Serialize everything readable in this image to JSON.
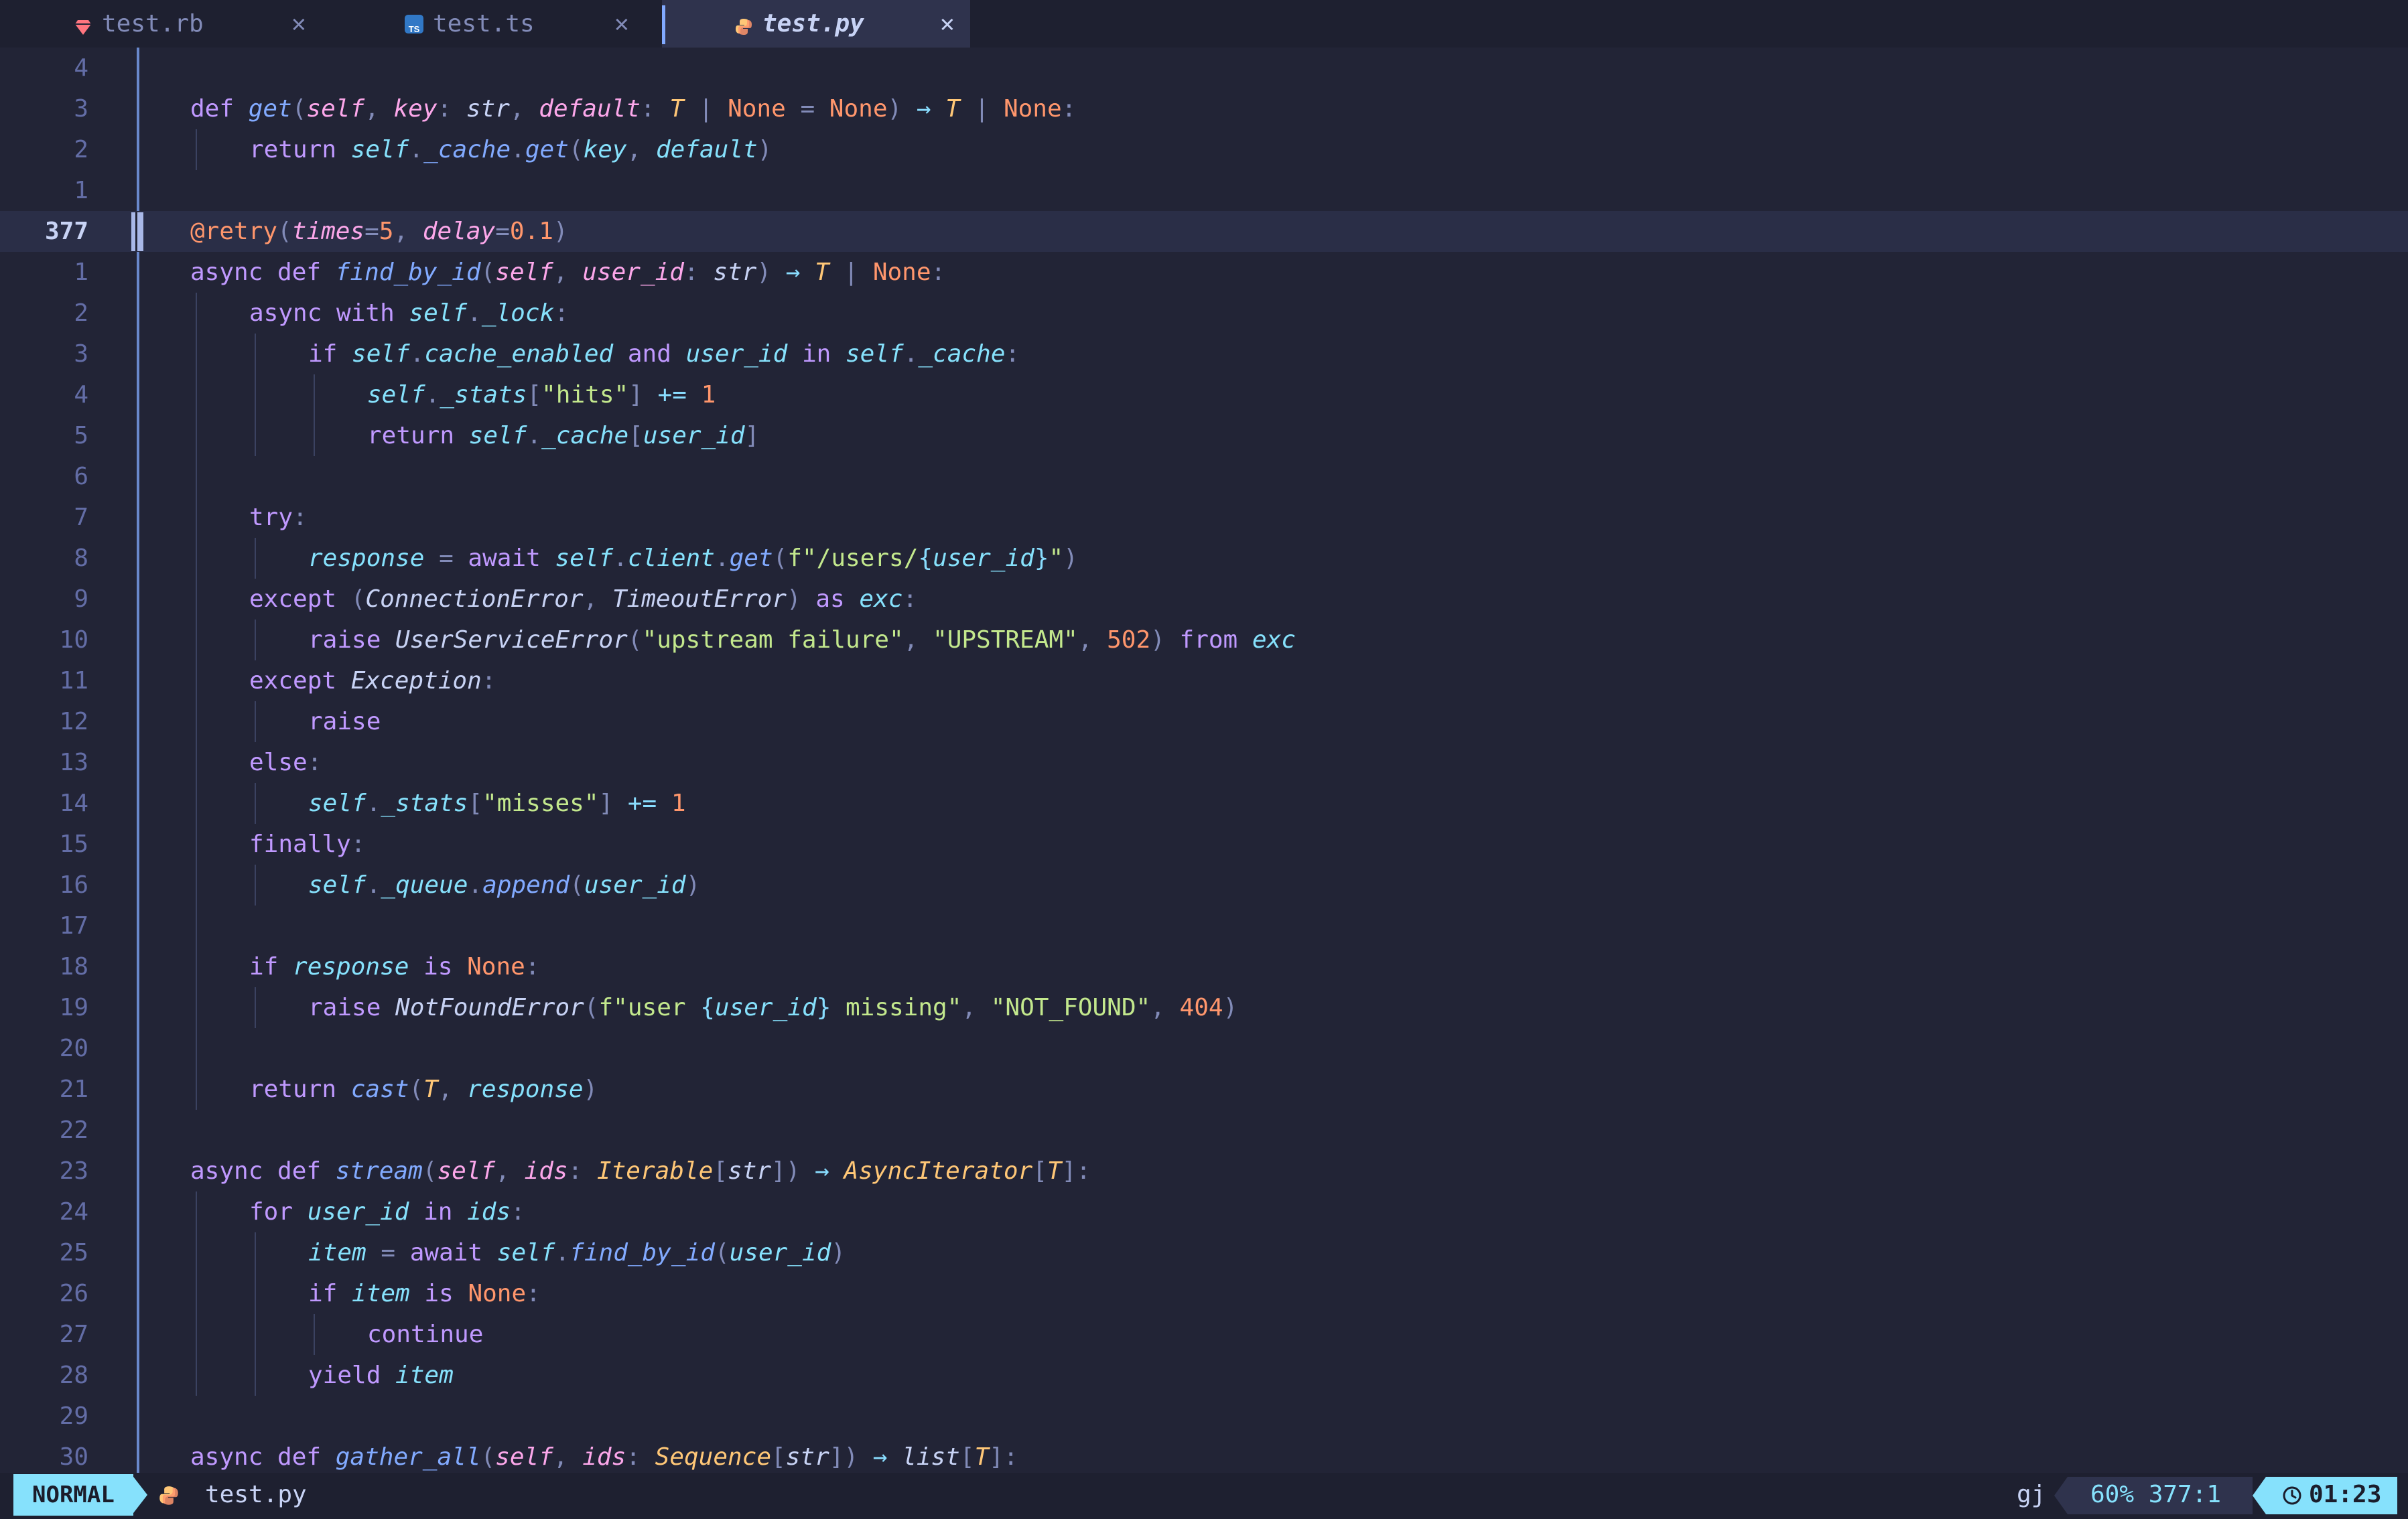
{
  "tabs": [
    {
      "label": "test.rb",
      "icon": "ruby-icon",
      "icon_color": "#ff757f"
    },
    {
      "label": "test.ts",
      "icon": "typescript-icon",
      "icon_color": "#3178c6"
    },
    {
      "label": "test.py",
      "icon": "python-icon",
      "icon_color": "#ffc777",
      "active": true
    }
  ],
  "close_glyph": "✕",
  "editor": {
    "current_line": 377,
    "lines": [
      {
        "n": "4",
        "indent": 0,
        "seg": []
      },
      {
        "n": "3",
        "indent": 1,
        "seg": [
          [
            "k",
            "def "
          ],
          [
            "f",
            "get"
          ],
          [
            "pu",
            "("
          ],
          [
            "p",
            "self"
          ],
          [
            "pu",
            ", "
          ],
          [
            "p",
            "key"
          ],
          [
            "pu",
            ": "
          ],
          [
            "i",
            "str"
          ],
          [
            "pu",
            ", "
          ],
          [
            "p",
            "default"
          ],
          [
            "pu",
            ": "
          ],
          [
            "c",
            "T"
          ],
          [
            "pu",
            " | "
          ],
          [
            "n",
            "None"
          ],
          [
            "pu",
            " = "
          ],
          [
            "n",
            "None"
          ],
          [
            "pu",
            ") "
          ],
          [
            "o",
            "→"
          ],
          [
            "pu",
            " "
          ],
          [
            "c",
            "T"
          ],
          [
            "pu",
            " | "
          ],
          [
            "n",
            "None"
          ],
          [
            "pu",
            ":"
          ]
        ]
      },
      {
        "n": "2",
        "indent": 2,
        "seg": [
          [
            "k",
            "return "
          ],
          [
            "v",
            "self"
          ],
          [
            "pu",
            "."
          ],
          [
            "f",
            "_cache"
          ],
          [
            "pu",
            "."
          ],
          [
            "f",
            "get"
          ],
          [
            "pu",
            "("
          ],
          [
            "v",
            "key"
          ],
          [
            "pu",
            ", "
          ],
          [
            "v",
            "default"
          ],
          [
            "pu",
            ")"
          ]
        ]
      },
      {
        "n": "1",
        "indent": 0,
        "seg": []
      },
      {
        "n": "377",
        "indent": 1,
        "cur": true,
        "seg": [
          [
            "n",
            "@retry"
          ],
          [
            "pu",
            "("
          ],
          [
            "p",
            "times"
          ],
          [
            "pu",
            "="
          ],
          [
            "n",
            "5"
          ],
          [
            "pu",
            ", "
          ],
          [
            "p",
            "delay"
          ],
          [
            "pu",
            "="
          ],
          [
            "n",
            "0.1"
          ],
          [
            "pu",
            ")"
          ]
        ]
      },
      {
        "n": "1",
        "indent": 1,
        "seg": [
          [
            "k",
            "async def "
          ],
          [
            "f",
            "find_by_id"
          ],
          [
            "pu",
            "("
          ],
          [
            "p",
            "self"
          ],
          [
            "pu",
            ", "
          ],
          [
            "p",
            "user_id"
          ],
          [
            "pu",
            ": "
          ],
          [
            "i",
            "str"
          ],
          [
            "pu",
            ") "
          ],
          [
            "o",
            "→"
          ],
          [
            "pu",
            " "
          ],
          [
            "c",
            "T"
          ],
          [
            "pu",
            " | "
          ],
          [
            "n",
            "None"
          ],
          [
            "pu",
            ":"
          ]
        ]
      },
      {
        "n": "2",
        "indent": 2,
        "seg": [
          [
            "k",
            "async with "
          ],
          [
            "v",
            "self"
          ],
          [
            "pu",
            "."
          ],
          [
            "v",
            "_lock"
          ],
          [
            "pu",
            ":"
          ]
        ]
      },
      {
        "n": "3",
        "indent": 3,
        "seg": [
          [
            "k",
            "if "
          ],
          [
            "v",
            "self"
          ],
          [
            "pu",
            "."
          ],
          [
            "v",
            "cache_enabled"
          ],
          [
            "k",
            " and "
          ],
          [
            "v",
            "user_id"
          ],
          [
            "k",
            " in "
          ],
          [
            "v",
            "self"
          ],
          [
            "pu",
            "."
          ],
          [
            "v",
            "_cache"
          ],
          [
            "pu",
            ":"
          ]
        ]
      },
      {
        "n": "4",
        "indent": 4,
        "seg": [
          [
            "v",
            "self"
          ],
          [
            "pu",
            "."
          ],
          [
            "v",
            "_stats"
          ],
          [
            "pu",
            "["
          ],
          [
            "s",
            "\"hits\""
          ],
          [
            "pu",
            "] "
          ],
          [
            "o",
            "+="
          ],
          [
            "pu",
            " "
          ],
          [
            "n",
            "1"
          ]
        ]
      },
      {
        "n": "5",
        "indent": 4,
        "seg": [
          [
            "k",
            "return "
          ],
          [
            "v",
            "self"
          ],
          [
            "pu",
            "."
          ],
          [
            "v",
            "_cache"
          ],
          [
            "pu",
            "["
          ],
          [
            "v",
            "user_id"
          ],
          [
            "pu",
            "]"
          ]
        ]
      },
      {
        "n": "6",
        "indent": 0,
        "seg": []
      },
      {
        "n": "7",
        "indent": 2,
        "seg": [
          [
            "k",
            "try"
          ],
          [
            "pu",
            ":"
          ]
        ]
      },
      {
        "n": "8",
        "indent": 3,
        "seg": [
          [
            "v",
            "response"
          ],
          [
            "pu",
            " = "
          ],
          [
            "k",
            "await "
          ],
          [
            "v",
            "self"
          ],
          [
            "pu",
            "."
          ],
          [
            "v",
            "client"
          ],
          [
            "pu",
            "."
          ],
          [
            "f",
            "get"
          ],
          [
            "pu",
            "("
          ],
          [
            "s",
            "f\"/users/"
          ],
          [
            "o",
            "{"
          ],
          [
            "v",
            "user_id"
          ],
          [
            "o",
            "}"
          ],
          [
            "s",
            "\""
          ],
          [
            "pu",
            ")"
          ]
        ]
      },
      {
        "n": "9",
        "indent": 2,
        "seg": [
          [
            "k",
            "except "
          ],
          [
            "pu",
            "("
          ],
          [
            "i",
            "ConnectionError"
          ],
          [
            "pu",
            ", "
          ],
          [
            "i",
            "TimeoutError"
          ],
          [
            "pu",
            ") "
          ],
          [
            "k",
            "as "
          ],
          [
            "v",
            "exc"
          ],
          [
            "pu",
            ":"
          ]
        ]
      },
      {
        "n": "10",
        "indent": 3,
        "seg": [
          [
            "k",
            "raise "
          ],
          [
            "i",
            "UserServiceError"
          ],
          [
            "pu",
            "("
          ],
          [
            "s",
            "\"upstream failure\""
          ],
          [
            "pu",
            ", "
          ],
          [
            "s",
            "\"UPSTREAM\""
          ],
          [
            "pu",
            ", "
          ],
          [
            "n",
            "502"
          ],
          [
            "pu",
            ") "
          ],
          [
            "k",
            "from "
          ],
          [
            "v",
            "exc"
          ]
        ]
      },
      {
        "n": "11",
        "indent": 2,
        "seg": [
          [
            "k",
            "except "
          ],
          [
            "i",
            "Exception"
          ],
          [
            "pu",
            ":"
          ]
        ]
      },
      {
        "n": "12",
        "indent": 3,
        "seg": [
          [
            "k",
            "raise"
          ]
        ]
      },
      {
        "n": "13",
        "indent": 2,
        "seg": [
          [
            "k",
            "else"
          ],
          [
            "pu",
            ":"
          ]
        ]
      },
      {
        "n": "14",
        "indent": 3,
        "seg": [
          [
            "v",
            "self"
          ],
          [
            "pu",
            "."
          ],
          [
            "v",
            "_stats"
          ],
          [
            "pu",
            "["
          ],
          [
            "s",
            "\"misses\""
          ],
          [
            "pu",
            "] "
          ],
          [
            "o",
            "+="
          ],
          [
            "pu",
            " "
          ],
          [
            "n",
            "1"
          ]
        ]
      },
      {
        "n": "15",
        "indent": 2,
        "seg": [
          [
            "k",
            "finally"
          ],
          [
            "pu",
            ":"
          ]
        ]
      },
      {
        "n": "16",
        "indent": 3,
        "seg": [
          [
            "v",
            "self"
          ],
          [
            "pu",
            "."
          ],
          [
            "v",
            "_queue"
          ],
          [
            "pu",
            "."
          ],
          [
            "f",
            "append"
          ],
          [
            "pu",
            "("
          ],
          [
            "v",
            "user_id"
          ],
          [
            "pu",
            ")"
          ]
        ]
      },
      {
        "n": "17",
        "indent": 0,
        "seg": []
      },
      {
        "n": "18",
        "indent": 2,
        "seg": [
          [
            "k",
            "if "
          ],
          [
            "v",
            "response"
          ],
          [
            "k",
            " is "
          ],
          [
            "n",
            "None"
          ],
          [
            "pu",
            ":"
          ]
        ]
      },
      {
        "n": "19",
        "indent": 3,
        "seg": [
          [
            "k",
            "raise "
          ],
          [
            "i",
            "NotFoundError"
          ],
          [
            "pu",
            "("
          ],
          [
            "s",
            "f\"user "
          ],
          [
            "o",
            "{"
          ],
          [
            "v",
            "user_id"
          ],
          [
            "o",
            "}"
          ],
          [
            "s",
            " missing\""
          ],
          [
            "pu",
            ", "
          ],
          [
            "s",
            "\"NOT_FOUND\""
          ],
          [
            "pu",
            ", "
          ],
          [
            "n",
            "404"
          ],
          [
            "pu",
            ")"
          ]
        ]
      },
      {
        "n": "20",
        "indent": 0,
        "seg": []
      },
      {
        "n": "21",
        "indent": 2,
        "seg": [
          [
            "k",
            "return "
          ],
          [
            "f",
            "cast"
          ],
          [
            "pu",
            "("
          ],
          [
            "c",
            "T"
          ],
          [
            "pu",
            ", "
          ],
          [
            "v",
            "response"
          ],
          [
            "pu",
            ")"
          ]
        ]
      },
      {
        "n": "22",
        "indent": 0,
        "seg": []
      },
      {
        "n": "23",
        "indent": 1,
        "seg": [
          [
            "k",
            "async def "
          ],
          [
            "f",
            "stream"
          ],
          [
            "pu",
            "("
          ],
          [
            "p",
            "self"
          ],
          [
            "pu",
            ", "
          ],
          [
            "p",
            "ids"
          ],
          [
            "pu",
            ": "
          ],
          [
            "c",
            "Iterable"
          ],
          [
            "pu",
            "["
          ],
          [
            "i",
            "str"
          ],
          [
            "pu",
            "]) "
          ],
          [
            "o",
            "→"
          ],
          [
            "pu",
            " "
          ],
          [
            "c",
            "AsyncIterator"
          ],
          [
            "pu",
            "["
          ],
          [
            "c",
            "T"
          ],
          [
            "pu",
            "]:"
          ]
        ]
      },
      {
        "n": "24",
        "indent": 2,
        "seg": [
          [
            "k",
            "for "
          ],
          [
            "v",
            "user_id"
          ],
          [
            "k",
            " in "
          ],
          [
            "v",
            "ids"
          ],
          [
            "pu",
            ":"
          ]
        ]
      },
      {
        "n": "25",
        "indent": 3,
        "seg": [
          [
            "v",
            "item"
          ],
          [
            "pu",
            " = "
          ],
          [
            "k",
            "await "
          ],
          [
            "v",
            "self"
          ],
          [
            "pu",
            "."
          ],
          [
            "f",
            "find_by_id"
          ],
          [
            "pu",
            "("
          ],
          [
            "v",
            "user_id"
          ],
          [
            "pu",
            ")"
          ]
        ]
      },
      {
        "n": "26",
        "indent": 3,
        "seg": [
          [
            "k",
            "if "
          ],
          [
            "v",
            "item"
          ],
          [
            "k",
            " is "
          ],
          [
            "n",
            "None"
          ],
          [
            "pu",
            ":"
          ]
        ]
      },
      {
        "n": "27",
        "indent": 4,
        "seg": [
          [
            "k",
            "continue"
          ]
        ]
      },
      {
        "n": "28",
        "indent": 3,
        "seg": [
          [
            "k",
            "yield "
          ],
          [
            "v",
            "item"
          ]
        ]
      },
      {
        "n": "29",
        "indent": 0,
        "seg": []
      },
      {
        "n": "30",
        "indent": 1,
        "seg": [
          [
            "k",
            "async def "
          ],
          [
            "f",
            "gather_all"
          ],
          [
            "pu",
            "("
          ],
          [
            "p",
            "self"
          ],
          [
            "pu",
            ", "
          ],
          [
            "p",
            "ids"
          ],
          [
            "pu",
            ": "
          ],
          [
            "c",
            "Sequence"
          ],
          [
            "pu",
            "["
          ],
          [
            "i",
            "str"
          ],
          [
            "pu",
            "]) "
          ],
          [
            "o",
            "→"
          ],
          [
            "pu",
            " "
          ],
          [
            "i",
            "list"
          ],
          [
            "pu",
            "["
          ],
          [
            "c",
            "T"
          ],
          [
            "pu",
            "]:"
          ]
        ]
      }
    ]
  },
  "status": {
    "mode": "NORMAL",
    "file": "test.py",
    "file_icon": "python-icon",
    "keys": "gj",
    "position": "60% 377:1",
    "clock_icon": "clock-icon",
    "time": "01:23"
  }
}
